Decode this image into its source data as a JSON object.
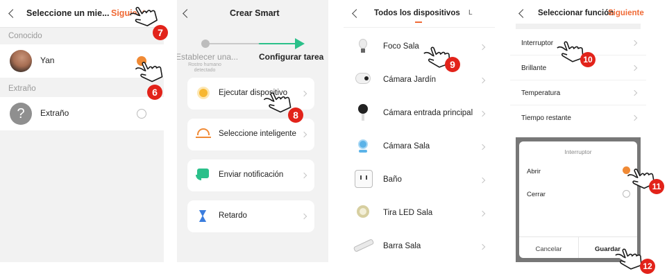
{
  "screen1": {
    "title": "Seleccione un mie...",
    "next": "Siguiente",
    "section_known": "Conocido",
    "member_name": "Yan",
    "section_stranger": "Extraño",
    "stranger_name": "Extraño",
    "stranger_icon": "question-mark-icon"
  },
  "screen2": {
    "title": "Crear Smart",
    "step1": "Establecer una...",
    "step1_sub": "Rostro humano detectado",
    "step2": "Configurar tarea",
    "actions": [
      {
        "label": "Ejecutar dispositivo",
        "icon": "sun-icon"
      },
      {
        "label": "Seleccione inteligente",
        "icon": "sunset-icon"
      },
      {
        "label": "Enviar notificación",
        "icon": "notification-icon"
      },
      {
        "label": "Retardo",
        "icon": "hourglass-icon"
      }
    ]
  },
  "screen3": {
    "title": "Todos los dispositivos",
    "tab_partial": "L",
    "devices": [
      {
        "name": "Foco Sala",
        "icon": "bulb-icon"
      },
      {
        "name": "Cámara Jardín",
        "icon": "camera-icon"
      },
      {
        "name": "Cámara entrada principal",
        "icon": "camera-icon"
      },
      {
        "name": "Cámara Sala",
        "icon": "camera-icon"
      },
      {
        "name": "Baño",
        "icon": "outlet-icon"
      },
      {
        "name": "Tira LED Sala",
        "icon": "led-strip-icon"
      },
      {
        "name": "Barra Sala",
        "icon": "power-strip-icon"
      }
    ]
  },
  "screen4": {
    "title": "Seleccionar función",
    "next": "Siguiente",
    "functions": [
      "Interruptor",
      "Brillante",
      "Temperatura",
      "Tiempo restante"
    ],
    "dialog": {
      "title": "Interruptor",
      "options": [
        "Abrir",
        "Cerrar"
      ],
      "selected": "Abrir",
      "cancel": "Cancelar",
      "save": "Guardar"
    }
  },
  "annotations": {
    "steps": [
      "6",
      "7",
      "8",
      "9",
      "10",
      "11",
      "12"
    ],
    "icon": "pointing-hand-icon",
    "badge_color": "#e2231a"
  },
  "colors": {
    "accent": "#f06a35",
    "selected_radio": "#f08a35",
    "gray_bg": "#f2f2f2"
  }
}
